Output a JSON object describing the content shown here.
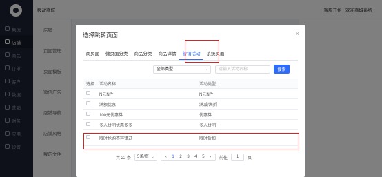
{
  "sidebar": {
    "items": [
      "概况",
      "店铺",
      "商品",
      "订单",
      "客户",
      "数据",
      "营销",
      "财务",
      "应用",
      "设置"
    ]
  },
  "topbar": {
    "crumb": "移动商城",
    "right_items": [
      "客服开始",
      "欢迎商城系统"
    ]
  },
  "subnav": {
    "items": [
      "店铺",
      "页面管理",
      "页面模板",
      "微信广告",
      "店铺导航",
      "店铺风格",
      "我的文件"
    ]
  },
  "modal": {
    "title": "选择跳转页面",
    "close": "×",
    "tabs": [
      "商页面",
      "微页面分类",
      "商品分类",
      "商品详情",
      "营销活动",
      "系统页面"
    ],
    "active_tab": "营销活动",
    "type_select": "全部类型",
    "search_placeholder": "请输入活动名称",
    "search_button": "搜索",
    "columns": [
      "选择",
      "活动名称",
      "活动类型"
    ],
    "rows": [
      {
        "name": "N元N件",
        "type": "N元N件"
      },
      {
        "name": "满额优惠",
        "type": "满减/满折"
      },
      {
        "name": "100元优惠券",
        "type": "优惠券"
      },
      {
        "name": "多人拼团优惠多多",
        "type": "多人拼团"
      },
      {
        "name": "限时抢购不容错过",
        "type": "限时折扣"
      }
    ],
    "pagination": {
      "total": "共 22 条",
      "page_size": "5条/页",
      "pages": [
        "‹",
        "1",
        "2",
        "3",
        "4",
        "5",
        "›"
      ],
      "current": "1",
      "goto_label": "前往",
      "goto_value": "1",
      "page_suffix": "页"
    }
  },
  "colors": {
    "accent": "#2d6cf6",
    "highlight": "#e02020",
    "sidebar_bg": "#1f2235"
  }
}
